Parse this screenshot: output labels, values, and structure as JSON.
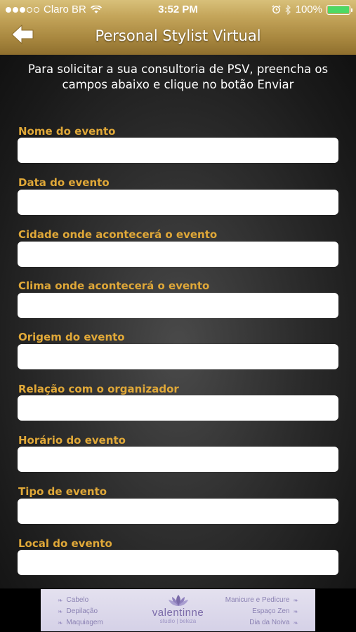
{
  "status": {
    "carrier": "Claro BR",
    "time": "3:52 PM",
    "battery": "100%",
    "signal_bars_filled": 3,
    "signal_bars_total": 5
  },
  "nav": {
    "title": "Personal Stylist Virtual",
    "back_icon": "back-arrow-icon"
  },
  "intro": "Para solicitar a sua consultoria de PSV, preencha os campos abaixo e clique no botão Enviar",
  "fields": [
    {
      "label": "Nome do evento",
      "value": ""
    },
    {
      "label": "Data do evento",
      "value": ""
    },
    {
      "label": "Cidade onde acontecerá o evento",
      "value": ""
    },
    {
      "label": "Clima onde acontecerá o evento",
      "value": ""
    },
    {
      "label": "Origem do evento",
      "value": ""
    },
    {
      "label": "Relação com o organizador",
      "value": ""
    },
    {
      "label": "Horário do evento",
      "value": ""
    },
    {
      "label": "Tipo de evento",
      "value": ""
    },
    {
      "label": "Local do evento",
      "value": ""
    }
  ],
  "ad": {
    "left_items": [
      "Cabelo",
      "Depilação",
      "Maquiagem"
    ],
    "right_items": [
      "Manicure e Pedicure",
      "Espaço Zen",
      "Dia da Noiva"
    ],
    "brand": "valentinne",
    "brand_sub": "studio | beleza"
  },
  "colors": {
    "accent_gold": "#c4a55a",
    "label_orange": "#e0a838",
    "ad_purple": "#7a6aa8"
  }
}
